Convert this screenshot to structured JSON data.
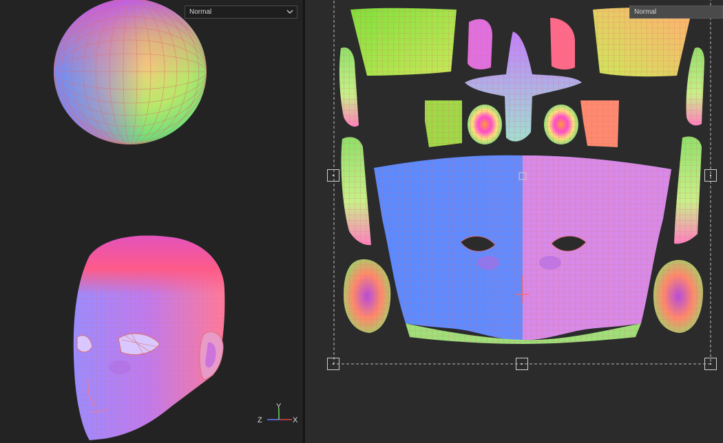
{
  "viewport_3d": {
    "shading_mode": "Normal",
    "axis_gizmo": {
      "x_label": "X",
      "y_label": "Y",
      "z_label": "Z"
    }
  },
  "viewport_uv": {
    "shading_mode": "Normal"
  },
  "colors": {
    "background": "#232323",
    "uv_background": "#2b2b2b",
    "wire": "#e06a6a",
    "normal_blue": "#6b8cff",
    "normal_pink": "#e08ae8",
    "normal_green": "#8fe06a"
  },
  "icons": {
    "dropdown": "chevron-down-icon",
    "gizmo": "axis-gizmo-icon"
  }
}
